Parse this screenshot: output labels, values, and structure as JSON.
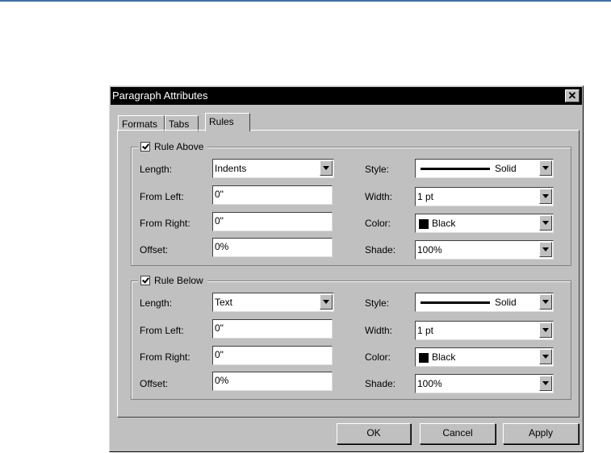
{
  "dialog": {
    "title": "Paragraph Attributes",
    "close_glyph": "✕"
  },
  "tabs": [
    {
      "label": "Formats"
    },
    {
      "label": "Tabs"
    },
    {
      "label": "Rules"
    }
  ],
  "labels": {
    "length": "Length:",
    "from_left": "From Left:",
    "from_right": "From Right:",
    "offset": "Offset:",
    "style": "Style:",
    "width": "Width:",
    "color": "Color:",
    "shade": "Shade:"
  },
  "rule_above": {
    "title": "Rule Above",
    "checked": true,
    "length": "Indents",
    "from_left": "0\"",
    "from_right": "0\"",
    "offset": "0%",
    "style": "Solid",
    "width": "1 pt",
    "color": "Black",
    "shade": "100%"
  },
  "rule_below": {
    "title": "Rule Below",
    "checked": true,
    "length": "Text",
    "from_left": "0\"",
    "from_right": "0\"",
    "offset": "0%",
    "style": "Solid",
    "width": "1 pt",
    "color": "Black",
    "shade": "100%"
  },
  "buttons": {
    "ok": "OK",
    "cancel": "Cancel",
    "apply": "Apply"
  },
  "colors": {
    "accent": "#3f6fa6",
    "dialog_bg": "#c0c0c0",
    "titlebar": "#000000"
  }
}
